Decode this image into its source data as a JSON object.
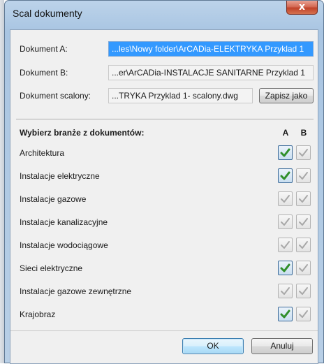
{
  "window": {
    "title": "Scal dokumenty",
    "close_glyph": "x"
  },
  "documents": {
    "a": {
      "label": "Dokument A:",
      "value": "...les\\Nowy folder\\ArCADia-ELEKTRYKA Przyklad 1"
    },
    "b": {
      "label": "Dokument B:",
      "value": "...er\\ArCADia-INSTALACJE SANITARNE Przyklad 1"
    },
    "merged": {
      "label": "Dokument scalony:",
      "value": "...TRYKA Przyklad 1- scalony.dwg",
      "save_as_label": "Zapisz jako"
    }
  },
  "branches": {
    "header": "Wybierz branże z dokumentów:",
    "col_a": "A",
    "col_b": "B",
    "items": [
      {
        "label": "Architektura",
        "a": true,
        "b": false
      },
      {
        "label": "Instalacje elektryczne",
        "a": true,
        "b": false
      },
      {
        "label": "Instalacje gazowe",
        "a": false,
        "b": false
      },
      {
        "label": "Instalacje kanalizacyjne",
        "a": false,
        "b": false
      },
      {
        "label": "Instalacje wodociągowe",
        "a": false,
        "b": false
      },
      {
        "label": "Sieci elektryczne",
        "a": true,
        "b": false
      },
      {
        "label": "Instalacje gazowe zewnętrzne",
        "a": false,
        "b": false
      },
      {
        "label": "Krajobraz",
        "a": true,
        "b": false
      }
    ]
  },
  "footer": {
    "ok_label": "OK",
    "cancel_label": "Anuluj"
  },
  "colors": {
    "check_on": "#2f8f2a",
    "check_off": "#a8a8a8",
    "selection": "#3399ff"
  }
}
